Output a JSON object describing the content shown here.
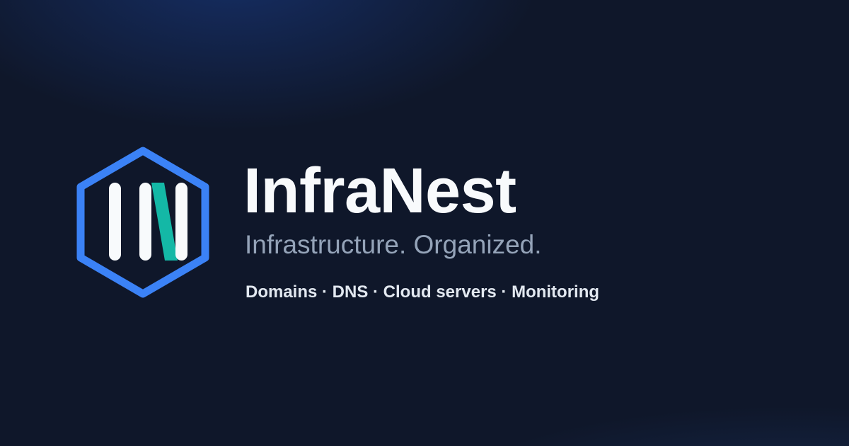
{
  "brand": {
    "name": "InfraNest",
    "tagline": "Infrastructure. Organized.",
    "features": "Domains · DNS · Cloud servers · Monitoring"
  },
  "logo": {
    "icon": "hexagon-in-monogram-icon",
    "hexagon_color": "#3b82f6",
    "bar_color": "#f8fafc",
    "accent_color": "#14b8a6"
  },
  "colors": {
    "background": "#0f172a",
    "title": "#f8fafc",
    "tagline": "#94a3b8",
    "features": "#e2e8f0"
  }
}
